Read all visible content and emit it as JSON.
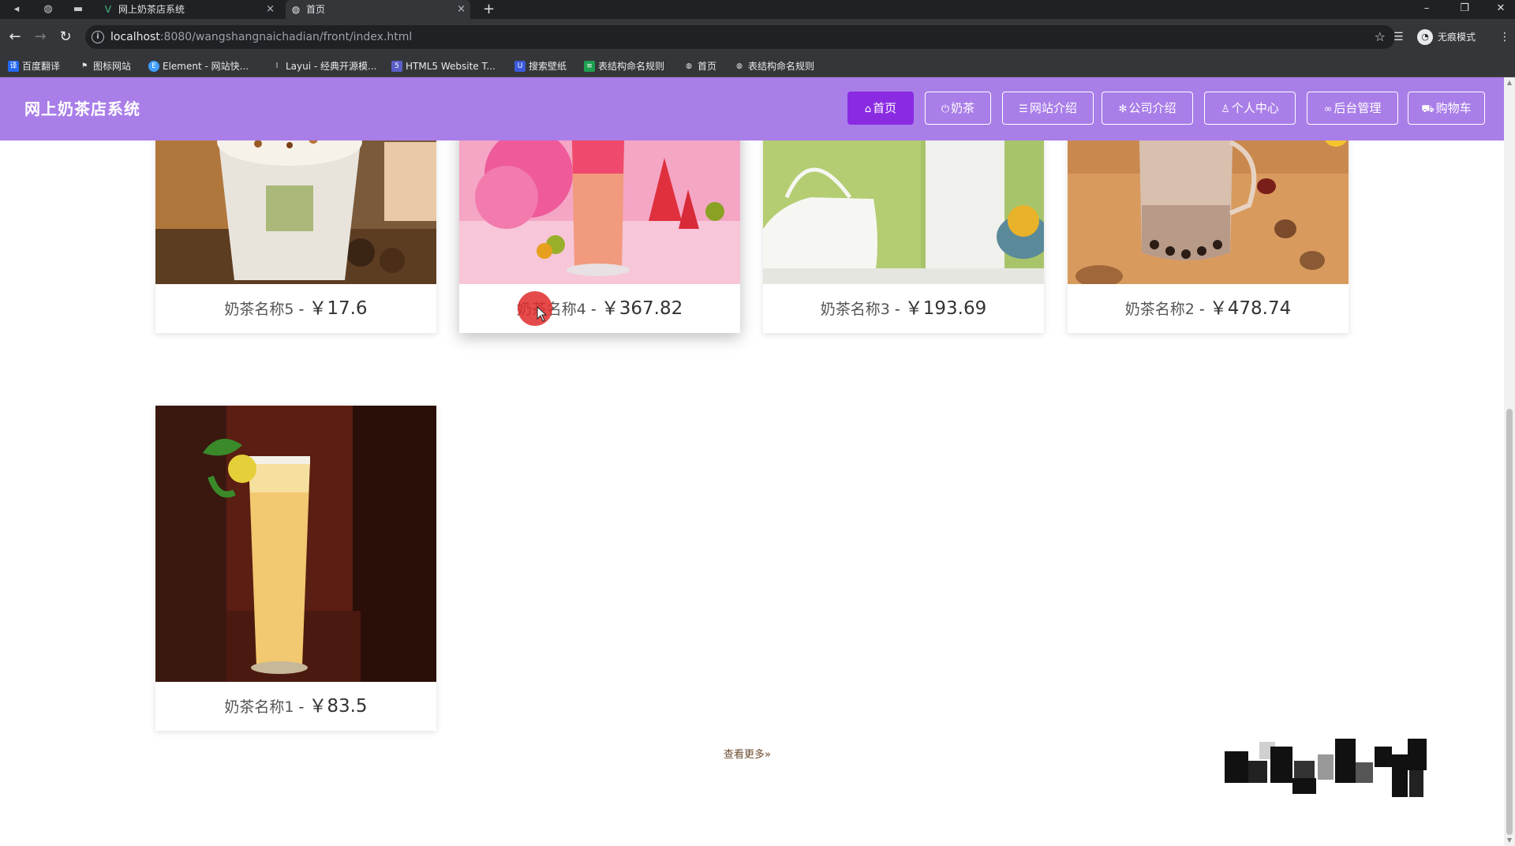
{
  "browser": {
    "tabs": [
      {
        "title": "网上奶茶店系统",
        "active": false
      },
      {
        "title": "首页",
        "active": true
      }
    ],
    "url_host": "localhost",
    "url_path": ":8080/wangshangnaichadian/front/index.html",
    "incognito_label": "无痕模式",
    "bookmarks": [
      "百度翻译",
      "图标网站",
      "Element - 网站快...",
      "Layui - 经典开源模...",
      "HTML5 Website T...",
      "搜索壁纸",
      "表结构命名规则",
      "首页",
      "表结构命名规则"
    ]
  },
  "site": {
    "title": "网上奶茶店系统",
    "nav": [
      {
        "label": "首页",
        "icon": "home-icon",
        "active": true
      },
      {
        "label": "奶茶",
        "icon": "power-icon",
        "active": false
      },
      {
        "label": "网站介绍",
        "icon": "list-icon",
        "active": false
      },
      {
        "label": "公司介绍",
        "icon": "snowflake-icon",
        "active": false
      },
      {
        "label": "个人中心",
        "icon": "user-icon",
        "active": false
      },
      {
        "label": "后台管理",
        "icon": "link-icon",
        "active": false
      },
      {
        "label": "购物车",
        "icon": "cart-icon",
        "active": false
      }
    ]
  },
  "products": [
    {
      "name": "奶茶名称5",
      "sep": "-",
      "price": "￥17.6"
    },
    {
      "name": "奶茶名称4",
      "sep": "-",
      "price": "￥367.82"
    },
    {
      "name": "奶茶名称3",
      "sep": "-",
      "price": "￥193.69"
    },
    {
      "name": "奶茶名称2",
      "sep": "-",
      "price": "￥478.74"
    },
    {
      "name": "奶茶名称1",
      "sep": "-",
      "price": "￥83.5"
    }
  ],
  "more_link": "查看更多",
  "colors": {
    "header": "#a97ee8",
    "nav_active": "#8a2be2",
    "more_link": "#6b4a2e"
  }
}
